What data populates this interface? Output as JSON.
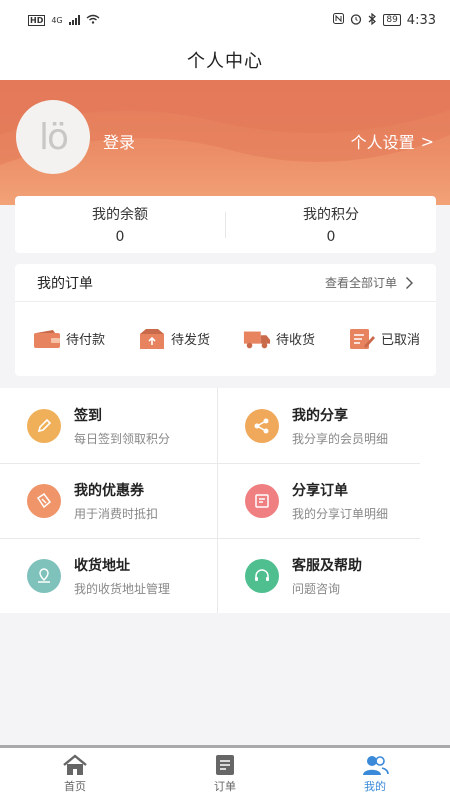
{
  "status_bar": {
    "left_badge": "HD",
    "network": "4G",
    "battery": "89",
    "time": "4:33"
  },
  "nav": {
    "title": "个人中心"
  },
  "profile": {
    "avatar_text": "lö",
    "login_label": "登录",
    "settings_label": "个人设置",
    "settings_chevron": ">"
  },
  "balance": {
    "balance_label": "我的余额",
    "balance_value": "0",
    "points_label": "我的积分",
    "points_value": "0"
  },
  "orders": {
    "title": "我的订单",
    "view_all": "查看全部订单",
    "chevron": ">",
    "items": [
      {
        "label": "待付款",
        "icon": "wallet-icon"
      },
      {
        "label": "待发货",
        "icon": "box-icon"
      },
      {
        "label": "待收货",
        "icon": "truck-icon"
      },
      {
        "label": "已取消",
        "icon": "edit-doc-icon"
      }
    ]
  },
  "features": [
    {
      "title": "签到",
      "subtitle": "每日签到领取积分",
      "icon": "pencil-icon",
      "color": "#f0b05a"
    },
    {
      "title": "我的分享",
      "subtitle": "我分享的会员明细",
      "icon": "share-icon",
      "color": "#f0a85a"
    },
    {
      "title": "我的优惠券",
      "subtitle": "用于消费时抵扣",
      "icon": "coupon-icon",
      "color": "#ef9569"
    },
    {
      "title": "分享订单",
      "subtitle": "我的分享订单明细",
      "icon": "order-doc-icon",
      "color": "#ef7f80"
    },
    {
      "title": "收货地址",
      "subtitle": "我的收货地址管理",
      "icon": "location-icon",
      "color": "#7fc1bb"
    },
    {
      "title": "客服及帮助",
      "subtitle": "问题咨询",
      "icon": "headset-icon",
      "color": "#4fbf8f"
    }
  ],
  "tabs": [
    {
      "label": "首页",
      "icon": "home-icon"
    },
    {
      "label": "订单",
      "icon": "order-list-icon"
    },
    {
      "label": "我的",
      "icon": "user-group-icon",
      "active": true
    }
  ],
  "colors": {
    "header_top": "#e5805f",
    "header_bottom": "#f2a277",
    "order_icon": "#e8835f",
    "tab_active": "#3b8ad9",
    "tab_inactive": "#666666"
  }
}
